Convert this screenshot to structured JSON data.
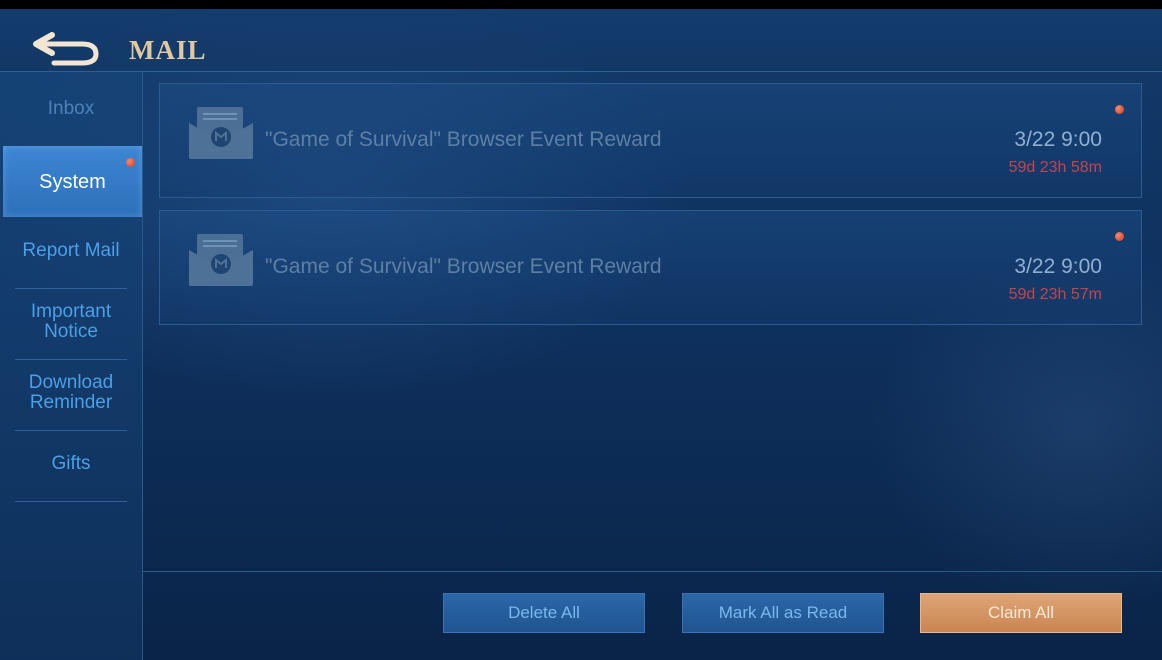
{
  "header": {
    "title": "MAIL"
  },
  "sidebar": {
    "items": [
      {
        "label": "Inbox"
      },
      {
        "label": "System",
        "active": true,
        "unread": true
      },
      {
        "label": "Report Mail"
      },
      {
        "label_line1": "Important",
        "label_line2": "Notice"
      },
      {
        "label_line1": "Download",
        "label_line2": "Reminder"
      },
      {
        "label": "Gifts"
      }
    ]
  },
  "mails": [
    {
      "title": "\"Game of Survival\" Browser Event Reward",
      "time": "3/22 9:00",
      "remaining": "59d 23h 58m",
      "unread": true
    },
    {
      "title": "\"Game of Survival\" Browser Event Reward",
      "time": "3/22 9:00",
      "remaining": "59d 23h 57m",
      "unread": true
    }
  ],
  "footer": {
    "delete_all": "Delete All",
    "mark_all_read": "Mark All as Read",
    "claim_all": "Claim All"
  },
  "colors": {
    "title_gold": "#e2c89c",
    "accent_blue": "#4b9fe6",
    "remaining_red": "#c5444a",
    "claim_orange": "#d6956a"
  }
}
